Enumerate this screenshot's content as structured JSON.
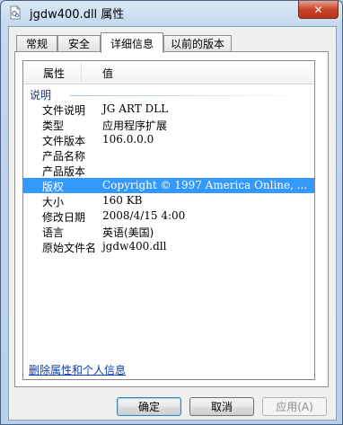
{
  "window": {
    "title": "jgdw400.dll 属性",
    "close_glyph": "✕"
  },
  "tabs": [
    {
      "label": "常规"
    },
    {
      "label": "安全"
    },
    {
      "label": "详细信息"
    },
    {
      "label": "以前的版本"
    }
  ],
  "listview": {
    "columns": [
      "属性",
      "值"
    ],
    "group": "说明",
    "rows": [
      {
        "key": "文件说明",
        "value": "JG ART DLL"
      },
      {
        "key": "类型",
        "value": "应用程序扩展"
      },
      {
        "key": "文件版本",
        "value": "106.0.0.0"
      },
      {
        "key": "产品名称",
        "value": ""
      },
      {
        "key": "产品版本",
        "value": ""
      },
      {
        "key": "版权",
        "value": "Copyright © 1997 America Online, ..."
      },
      {
        "key": "大小",
        "value": "160 KB"
      },
      {
        "key": "修改日期",
        "value": "2008/4/15 4:00"
      },
      {
        "key": "语言",
        "value": "英语(美国)"
      },
      {
        "key": "原始文件名",
        "value": "jgdw400.dll"
      }
    ],
    "selected_row": "版权"
  },
  "links": {
    "remove_properties": "删除属性和个人信息"
  },
  "buttons": {
    "ok": "确定",
    "cancel": "取消",
    "apply": "应用(A)"
  }
}
